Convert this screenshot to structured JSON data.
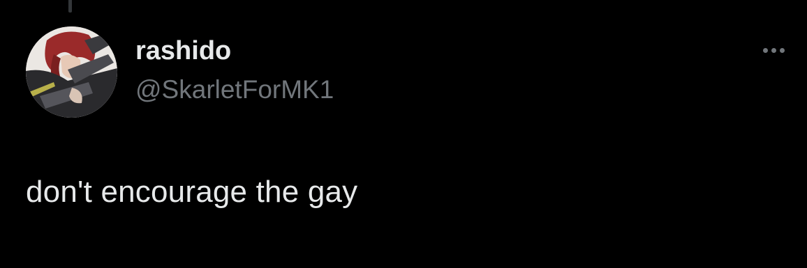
{
  "colors": {
    "background": "#000000",
    "primary_text": "#e7e9ea",
    "secondary_text": "#71767b",
    "thread_line": "#333639"
  },
  "author": {
    "display_name": "rashido",
    "handle": "@SkarletForMK1",
    "avatar": "profile-avatar-anime-character"
  },
  "menu": {
    "icon": "more-horizontal-icon"
  },
  "tweet": {
    "text": "don't encourage the gay"
  }
}
